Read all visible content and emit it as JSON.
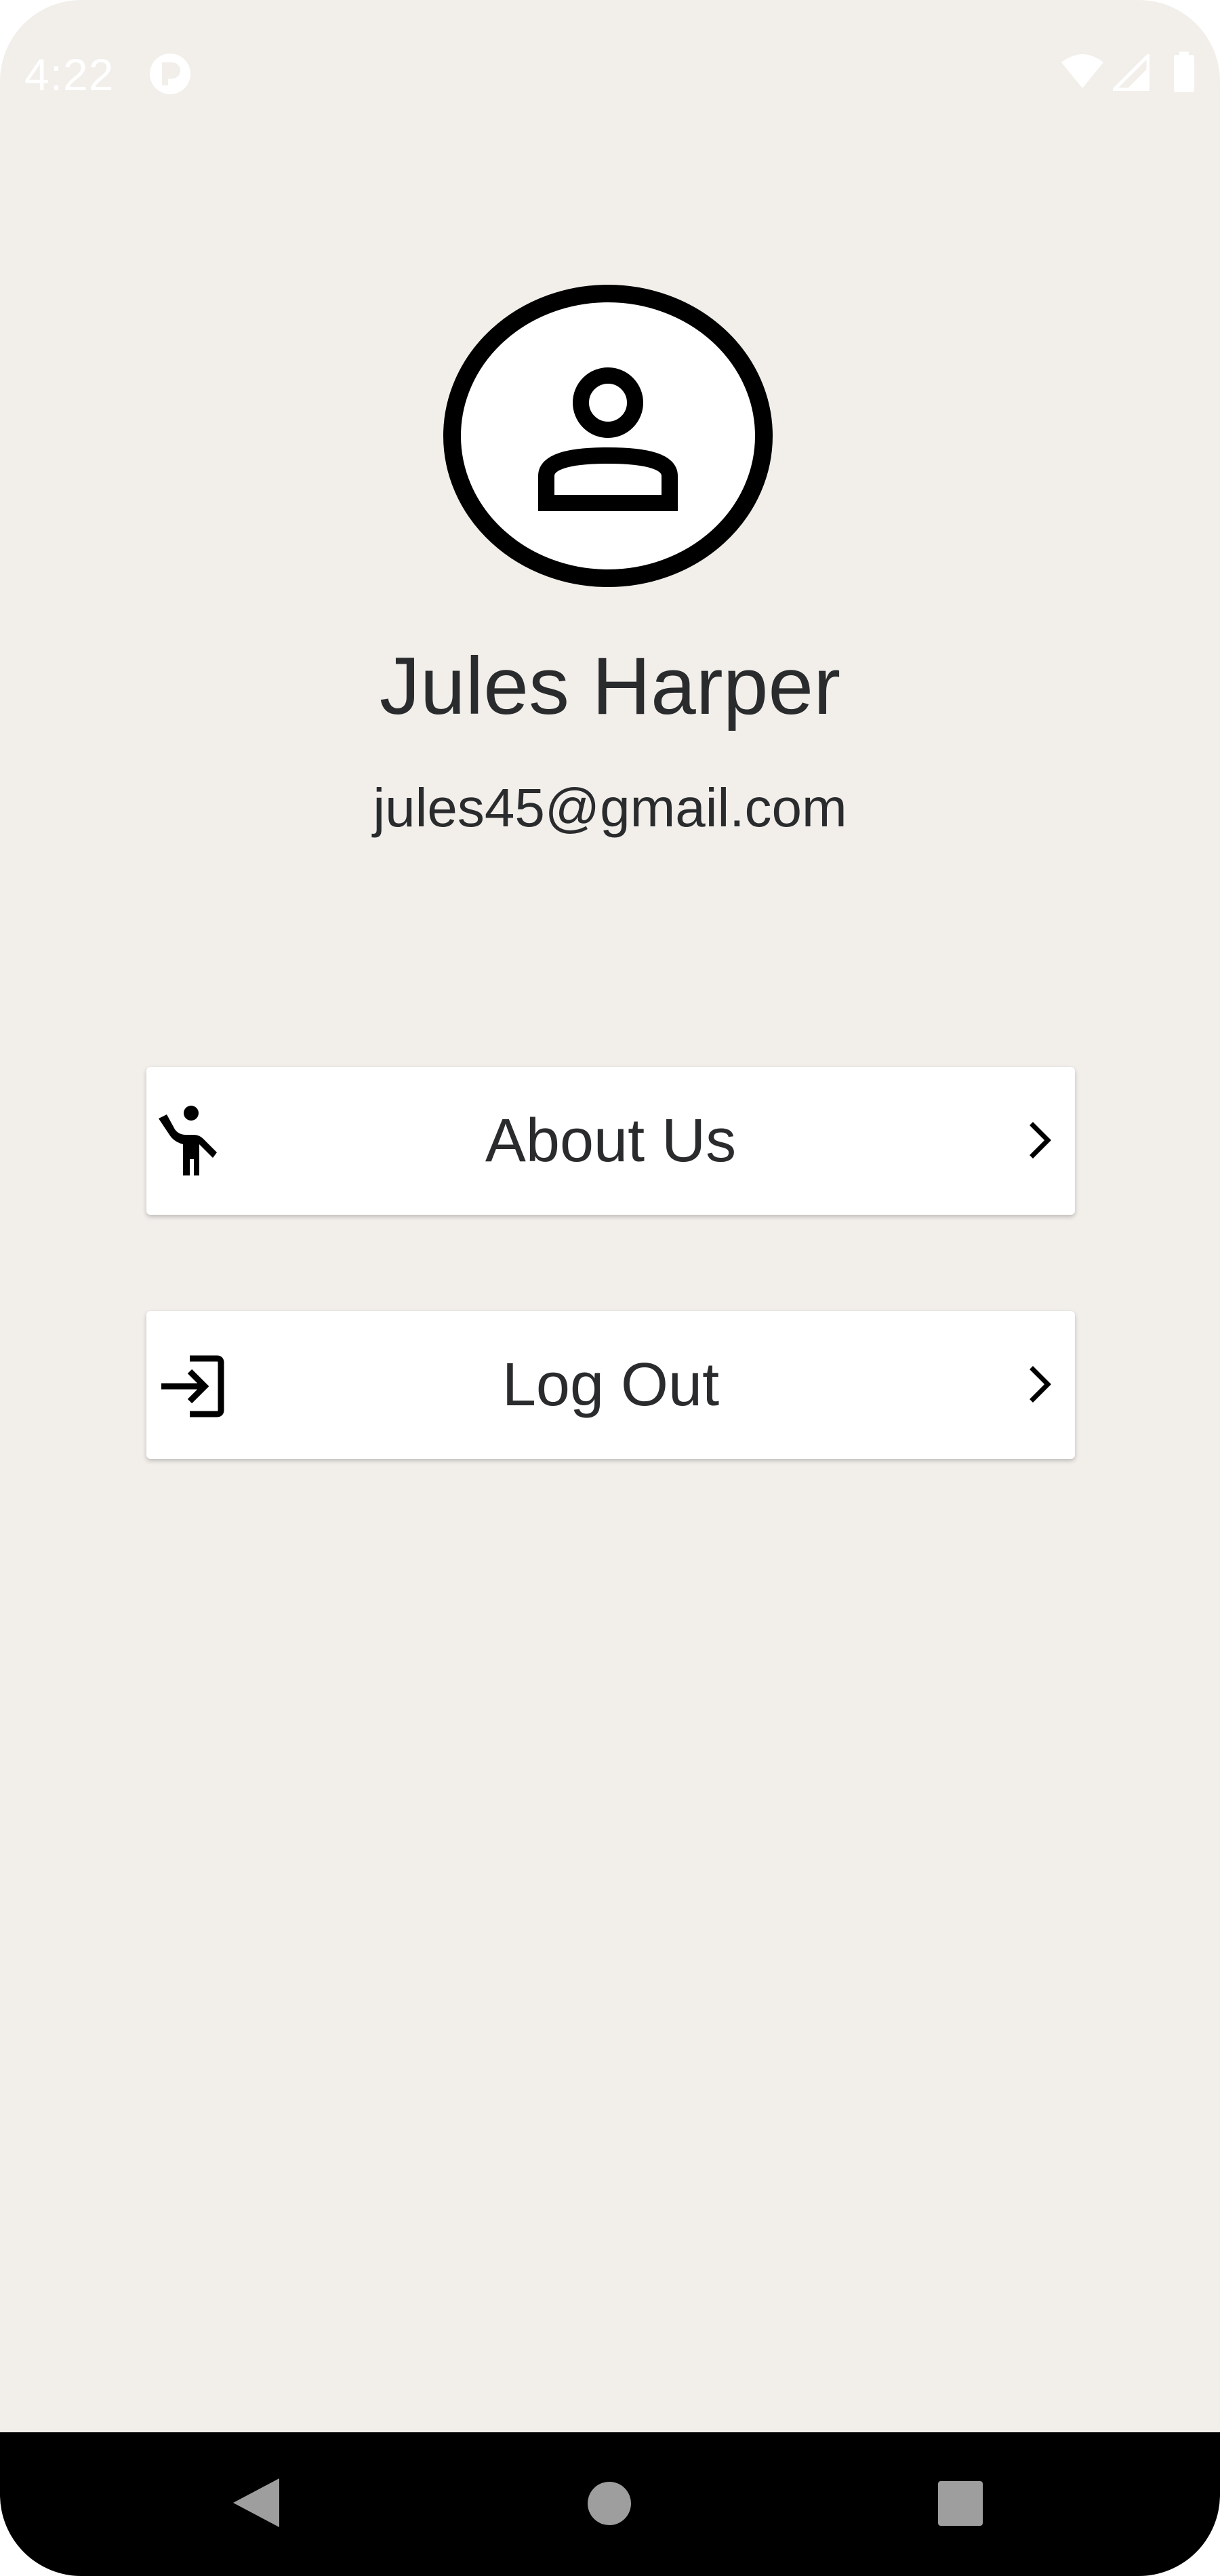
{
  "status_bar": {
    "time": "4:22",
    "icons": [
      "app-notification-icon",
      "wifi-icon",
      "cell-signal-icon",
      "battery-icon"
    ]
  },
  "profile": {
    "avatar_icon": "account-circle-icon",
    "name": "Jules Harper",
    "email": "jules45@gmail.com"
  },
  "menu": {
    "items": [
      {
        "label": "About Us",
        "icon": "person-waving-icon",
        "trailing_icon": "chevron-right-icon"
      },
      {
        "label": "Log Out",
        "icon": "login-arrow-icon",
        "trailing_icon": "chevron-right-icon"
      }
    ]
  },
  "nav_bar": {
    "buttons": [
      "back-triangle-icon",
      "home-circle-icon",
      "recents-square-icon"
    ]
  },
  "colors": {
    "background": "#f2efeb",
    "card": "#ffffff",
    "text": "#2a2b2d",
    "nav_bar": "#000000"
  }
}
